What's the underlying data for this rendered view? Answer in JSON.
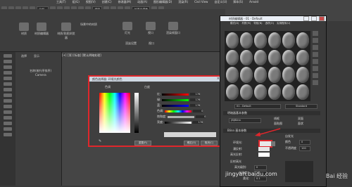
{
  "menubar": {
    "items": [
      "工具(T)",
      "组(G)",
      "视图(V)",
      "创建(C)",
      "修改器(M)",
      "动画(A)",
      "图形编辑器(D)",
      "渲染(R)",
      "Civil View",
      "自定义(U)",
      "脚本(S)",
      "Arnold"
    ]
  },
  "toolbar": {
    "view_dropdown": "视图",
    "selset_dropdown": "创建选择集"
  },
  "ribbon": {
    "items": [
      "材质",
      "材质编辑器",
      "材质/贴图浏览器",
      "场景中的材质",
      "灯光",
      "视口",
      "渲染帧窗口",
      "连续渲染",
      "视口",
      "渲染设置"
    ]
  },
  "scene": {
    "tabs": [
      "选择",
      "显示"
    ],
    "group_label": "名称(按升序排序)",
    "item": "Camera"
  },
  "viewport": {
    "label": "[+] [顶] [标准] [默认明暗处理]"
  },
  "color_picker": {
    "title": "颜色选择器: 环境光颜色",
    "white_label": "白度",
    "hue_label": "色调",
    "rows": [
      {
        "label": "红:",
        "value": "176"
      },
      {
        "label": "绿:",
        "value": "176"
      },
      {
        "label": "蓝:",
        "value": "176"
      },
      {
        "label": "色调:",
        "value": "0"
      },
      {
        "label": "饱和度:",
        "value": "0"
      },
      {
        "label": "亮度:",
        "value": "176"
      }
    ],
    "buttons": {
      "reset": "重置(R)",
      "ok": "确定(O)",
      "cancel": "取消(C)"
    }
  },
  "material_editor": {
    "title": "材质编辑器 - 01 - Default",
    "menu": [
      "模式(D)",
      "材质(M)",
      "导航(N)",
      "选项(O)",
      "实用程序(U)"
    ],
    "slot_count": 24,
    "name_field": "01 - Default",
    "type_button": "Standard",
    "shader_rollout": "明暗器基本参数",
    "shader_type": "(B)Blinn",
    "checkboxes": [
      "线框",
      "双面",
      "面贴图",
      "面状"
    ],
    "blinn_rollout": "Blinn 基本参数",
    "self_illum": "自发光",
    "labels": {
      "ambient": "环境光:",
      "diffuse": "漫反射:",
      "specular": "高光反射:",
      "color": "颜色",
      "opacity": "不透明度",
      "specular_hl": "反射高光",
      "spec_level": "高光级别:",
      "gloss": "光泽度:",
      "soften": "柔化:"
    },
    "values": {
      "spec_level": "0",
      "gloss": "10",
      "soften": "0.1",
      "opacity": "100",
      "self_illum": "0"
    }
  },
  "watermark": {
    "text1": "jingyan.baidu.com",
    "text2": "Bai 经验"
  }
}
